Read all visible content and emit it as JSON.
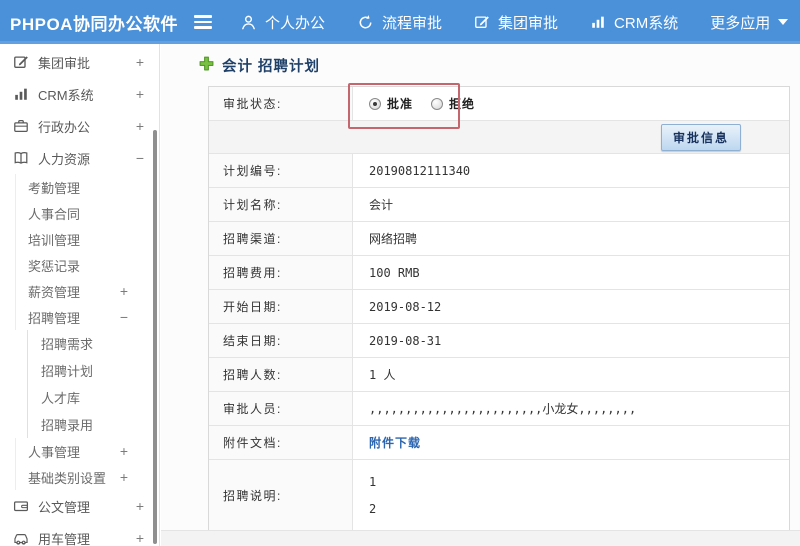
{
  "colors": {
    "topbar_blue": "#4a91da",
    "link_blue": "#2c66b0",
    "title_navy": "#1f4068",
    "annotation_red": "#c4666e",
    "plus_green": "#7ac143"
  },
  "topbar": {
    "logo": "PHPOA协同办公软件",
    "menu_icon": "hamburger-icon",
    "items": [
      {
        "label": "个人办公",
        "icon": "person-icon"
      },
      {
        "label": "流程审批",
        "icon": "cycle-icon"
      },
      {
        "label": "集团审批",
        "icon": "edit-icon"
      },
      {
        "label": "CRM系统",
        "icon": "chart-icon"
      },
      {
        "label": "更多应用",
        "icon": "caret-down-icon"
      }
    ]
  },
  "sidebar": {
    "items": [
      {
        "label": "集团审批",
        "icon": "edit-icon",
        "level": 0,
        "toggle": "+"
      },
      {
        "label": "CRM系统",
        "icon": "chart-icon",
        "level": 0,
        "toggle": "+"
      },
      {
        "label": "行政办公",
        "icon": "briefcase-icon",
        "level": 0,
        "toggle": "+"
      },
      {
        "label": "人力资源",
        "icon": "book-icon",
        "level": 0,
        "toggle": "−"
      },
      {
        "label": "考勤管理",
        "level": 1
      },
      {
        "label": "人事合同",
        "level": 1
      },
      {
        "label": "培训管理",
        "level": 1
      },
      {
        "label": "奖惩记录",
        "level": 1
      },
      {
        "label": "薪资管理",
        "level": 1,
        "toggle": "+"
      },
      {
        "label": "招聘管理",
        "level": 1,
        "toggle": "−"
      },
      {
        "label": "招聘需求",
        "level": 2
      },
      {
        "label": "招聘计划",
        "level": 2
      },
      {
        "label": "人才库",
        "level": 2
      },
      {
        "label": "招聘录用",
        "level": 2
      },
      {
        "label": "人事管理",
        "level": 1,
        "toggle": "+"
      },
      {
        "label": "基础类别设置",
        "level": 1,
        "toggle": "+"
      },
      {
        "label": "公文管理",
        "icon": "folder-icon",
        "level": 0,
        "toggle": "+"
      },
      {
        "label": "用车管理",
        "icon": "car-icon",
        "level": 0,
        "toggle": "+"
      }
    ]
  },
  "main": {
    "title": "会计 招聘计划",
    "title_icon": "add-icon",
    "approval_status": {
      "label": "审批状态:",
      "options": [
        {
          "label": "批准",
          "selected": true
        },
        {
          "label": "拒绝",
          "selected": false
        }
      ]
    },
    "approval_info_button": "审批信息",
    "fields": [
      {
        "label": "计划编号:",
        "value": "20190812111340"
      },
      {
        "label": "计划名称:",
        "value": "会计"
      },
      {
        "label": "招聘渠道:",
        "value": "网络招聘"
      },
      {
        "label": "招聘费用:",
        "value": "100 RMB"
      },
      {
        "label": "开始日期:",
        "value": "2019-08-12"
      },
      {
        "label": "结束日期:",
        "value": "2019-08-31"
      },
      {
        "label": "招聘人数:",
        "value": "1 人"
      },
      {
        "label": "审批人员:",
        "value": ",,,,,,,,,,,,,,,,,,,,,,,,小龙女,,,,,,,,"
      },
      {
        "label": "附件文档:",
        "value": "附件下载",
        "type": "link"
      },
      {
        "label": "招聘说明:",
        "lines": [
          "1",
          "2"
        ],
        "type": "multiline"
      }
    ]
  }
}
